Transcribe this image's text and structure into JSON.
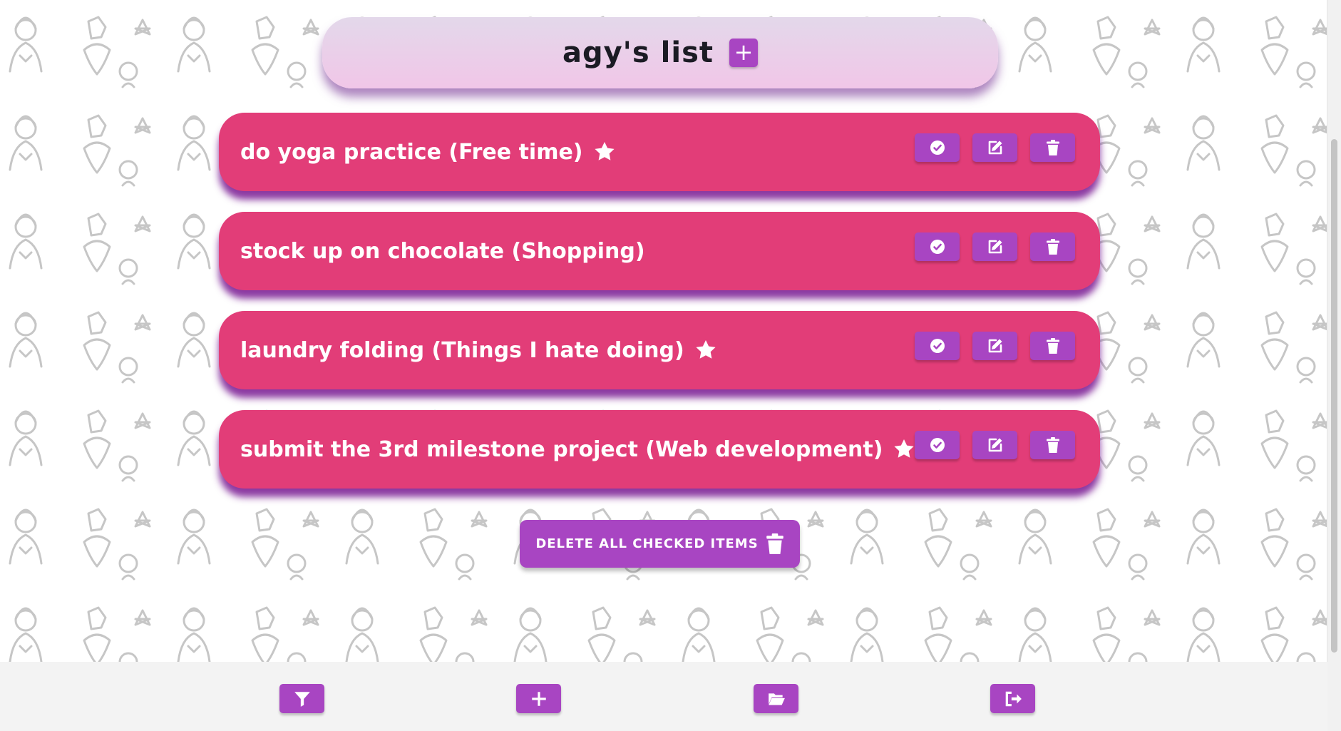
{
  "header": {
    "title": "agy's list",
    "add_icon": "plus-icon"
  },
  "items": [
    {
      "text": "do yoga practice (Free time)",
      "starred": true
    },
    {
      "text": "stock up on chocolate (Shopping)",
      "starred": false
    },
    {
      "text": "laundry folding (Things I hate doing)",
      "starred": true
    },
    {
      "text": "submit the 3rd milestone project (Web development)",
      "starred": true
    }
  ],
  "item_actions": [
    "check-circle-icon",
    "edit-icon",
    "trash-icon"
  ],
  "delete_all": {
    "label": "DELETE ALL CHECKED ITEMS",
    "icon": "trash-icon"
  },
  "footer": {
    "buttons": [
      "filter-icon",
      "plus-icon",
      "folder-open-icon",
      "sign-out-icon"
    ]
  },
  "colors": {
    "accent_purple": "#a845c2",
    "item_pink": "#e23d78",
    "header_bg": "#f1c6e8",
    "footer_bg": "#f3f3f3",
    "pattern_stroke": "#c6c6c6"
  }
}
